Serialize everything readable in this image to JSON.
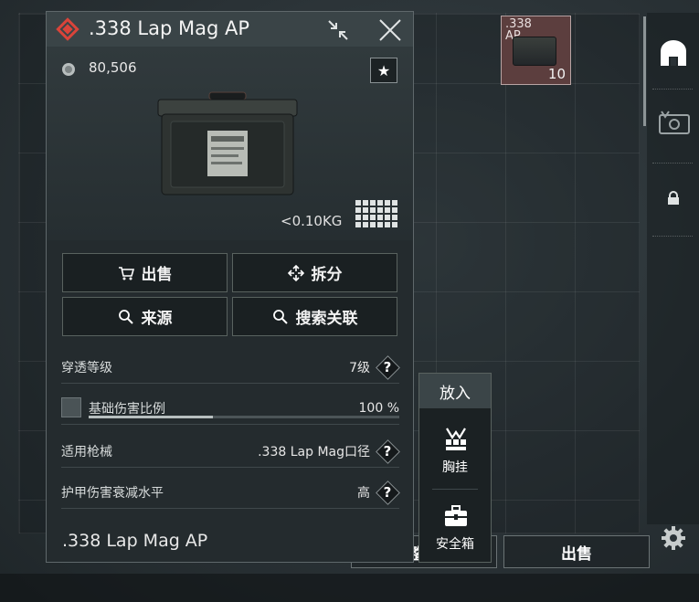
{
  "inventory": {
    "grid_item": {
      "label": ".338 AP",
      "count": "10"
    },
    "bottom_buttons": {
      "left_label": "整理",
      "right_label": "出售"
    }
  },
  "panel": {
    "title": ".338 Lap Mag AP",
    "price": "80,506",
    "weight": "<0.10KG",
    "actions": {
      "sell": "出售",
      "split": "拆分",
      "source": "来源",
      "search_related": "搜索关联"
    },
    "stats": [
      {
        "label": "穿透等级",
        "value": "7级"
      },
      {
        "label": "基础伤害比例",
        "value": "100 %",
        "progress": 1.0
      },
      {
        "label": "适用枪械",
        "value": ".338 Lap Mag口径"
      },
      {
        "label": "护甲伤害衰减水平",
        "value": "高"
      }
    ],
    "help_symbol": "?",
    "footer_name": ".338 Lap Mag AP",
    "fav_symbol": "★"
  },
  "context_menu": {
    "header": "放入",
    "items": [
      {
        "label": "胸挂",
        "icon": "chest-rig-icon"
      },
      {
        "label": "安全箱",
        "icon": "safe-box-icon"
      }
    ]
  },
  "colors": {
    "panel_bg": "#242b2e",
    "header_bg": "#3a4447",
    "rarity_red": "#d9443a",
    "selected_item": "#5c3e3e"
  }
}
